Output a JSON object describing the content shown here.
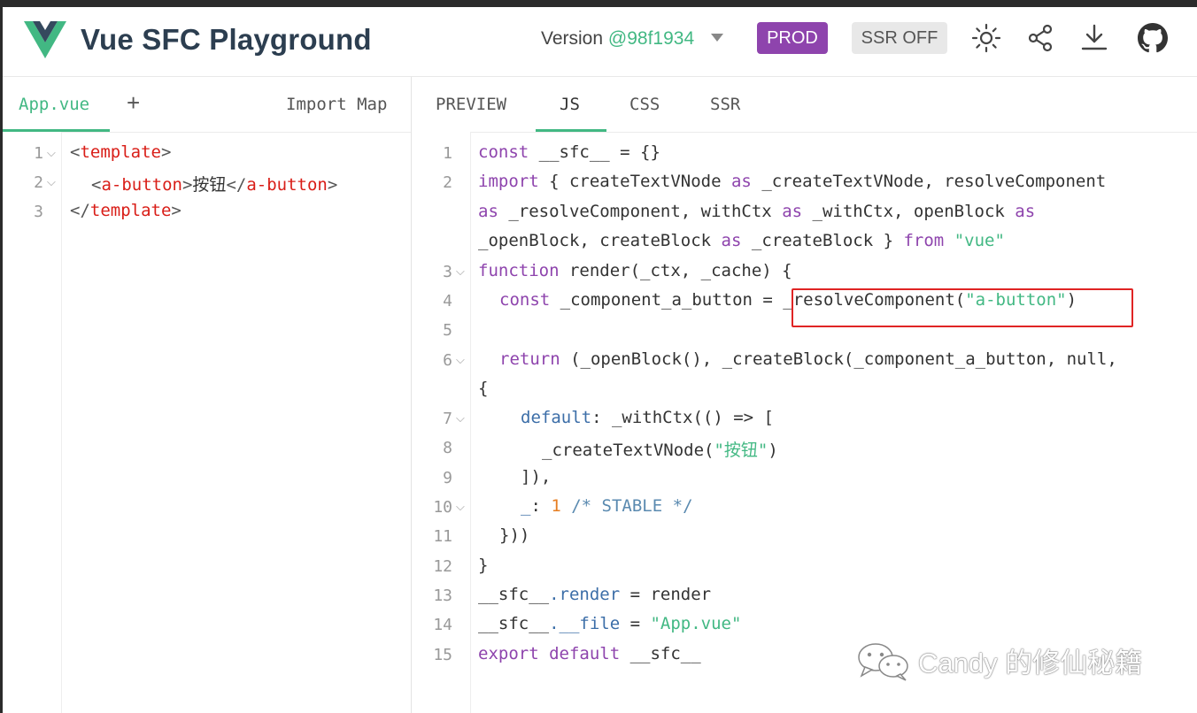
{
  "header": {
    "title": "Vue SFC Playground",
    "version_label": "Version",
    "version_hash": "@98f1934",
    "prod_label": "PROD",
    "ssr_label": "SSR OFF",
    "icons": [
      "theme-sun-icon",
      "share-icon",
      "download-icon",
      "github-icon"
    ]
  },
  "editor": {
    "tabs": [
      "App.vue"
    ],
    "add_label": "+",
    "import_map_label": "Import Map",
    "lines": [
      {
        "n": "1",
        "fold": true
      },
      {
        "n": "2",
        "fold": true
      },
      {
        "n": "3",
        "fold": false
      }
    ],
    "code": {
      "l1_open": "<",
      "l1_tag": "template",
      "l1_close": ">",
      "l2_open": "<",
      "l2_tag": "a-button",
      "l2_close": ">",
      "l2_text": "按钮",
      "l2_end_open": "</",
      "l2_end_tag": "a-button",
      "l2_end_close": ">",
      "l3_open": "</",
      "l3_tag": "template",
      "l3_close": ">"
    }
  },
  "output": {
    "tabs": [
      "PREVIEW",
      "JS",
      "CSS",
      "SSR"
    ],
    "active_tab": "JS",
    "line_numbers": [
      "1",
      "2",
      "3",
      "4",
      "5",
      "6",
      "7",
      "8",
      "9",
      "10",
      "11",
      "12",
      "13",
      "14",
      "15"
    ],
    "code": {
      "c1_kw": "const",
      "c1_rest": " __sfc__ = {}",
      "c2_kw": "import",
      "c2_a": " { createTextVNode ",
      "c2_as1": "as",
      "c2_b": " _createTextVNode, resolveComponent",
      "c2w_as2": "as",
      "c2w_a": " _resolveComponent, withCtx ",
      "c2w_as3": "as",
      "c2w_b": " _withCtx, openBlock ",
      "c2w_as4": "as",
      "c2w2_a": "_openBlock, createBlock ",
      "c2w2_as5": "as",
      "c2w2_b": " _createBlock } ",
      "c2w2_from": "from",
      "c2w2_str": "\"vue\"",
      "c3_kw": "function",
      "c3_rest": " render(_ctx, _cache) {",
      "c4_kw": "const",
      "c4_rest": " _component_a_button = _resolveComponent(",
      "c4_str": "\"a-button\"",
      "c4_end": ")",
      "c6_kw": "return",
      "c6_rest": " (_openBlock(), _createBlock(_component_a_button, null,",
      "c6w": "{",
      "c7_prop": "default",
      "c7_rest": ": _withCtx(() => [",
      "c8_a": "_createTextVNode(",
      "c8_str": "\"按钮\"",
      "c8_b": ")",
      "c9": "]),",
      "c10_prop": "_",
      "c10_colon": ": ",
      "c10_num": "1",
      "c10_cmt": " /* STABLE */",
      "c11": "}))",
      "c12": "}",
      "c13_a": "__sfc__",
      "c13_prop": ".render",
      "c13_b": " = render",
      "c14_a": "__sfc__",
      "c14_prop": ".__file",
      "c14_b": " = ",
      "c14_str": "\"App.vue\"",
      "c15_kw1": "export",
      "c15_kw2": "default",
      "c15_rest": " __sfc__"
    }
  },
  "watermark": {
    "text": "Candy 的修仙秘籍",
    "icon": "wechat-icon"
  }
}
